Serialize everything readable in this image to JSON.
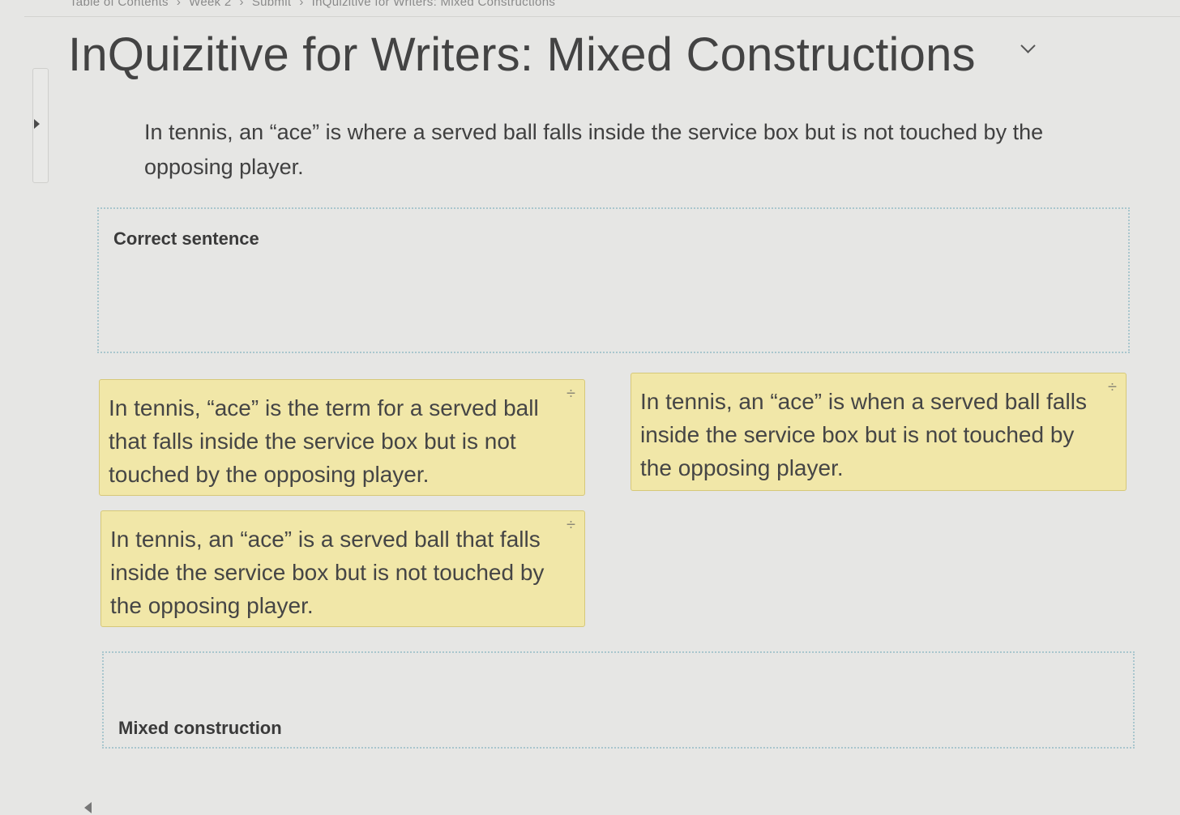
{
  "breadcrumb": {
    "items": [
      "Table of Contents",
      "Week 2",
      "Submit",
      "InQuizitive for Writers: Mixed Constructions"
    ],
    "separator": "›"
  },
  "page": {
    "title": "InQuizitive for Writers: Mixed Constructions"
  },
  "question": {
    "prompt": "In tennis, an “ace” is where a served ball falls inside the service box but is not touched by the opposing player."
  },
  "dropzones": {
    "correct_label": "Correct sentence",
    "mixed_label": "Mixed construction"
  },
  "cards": [
    {
      "text": "In tennis, “ace” is the term for a served ball that falls inside the service box but is not touched by the opposing player.",
      "handle": "÷"
    },
    {
      "text": "In tennis, an “ace” is when a served ball falls inside the service box but is not touched by the opposing player.",
      "handle": "÷"
    },
    {
      "text": "In tennis, an “ace” is a served ball that falls inside the service box but is not touched by the opposing player.",
      "handle": "÷"
    }
  ],
  "icons": {
    "title_toggle": "chevron-down-icon",
    "side_panel_toggle": "caret-right-icon",
    "drag_handle": "drag-handle-icon",
    "page_back": "caret-left-icon"
  },
  "colors": {
    "card_background": "#f1e7a8",
    "dropzone_border": "#a9c6cd",
    "page_background": "#e6e6e4"
  }
}
